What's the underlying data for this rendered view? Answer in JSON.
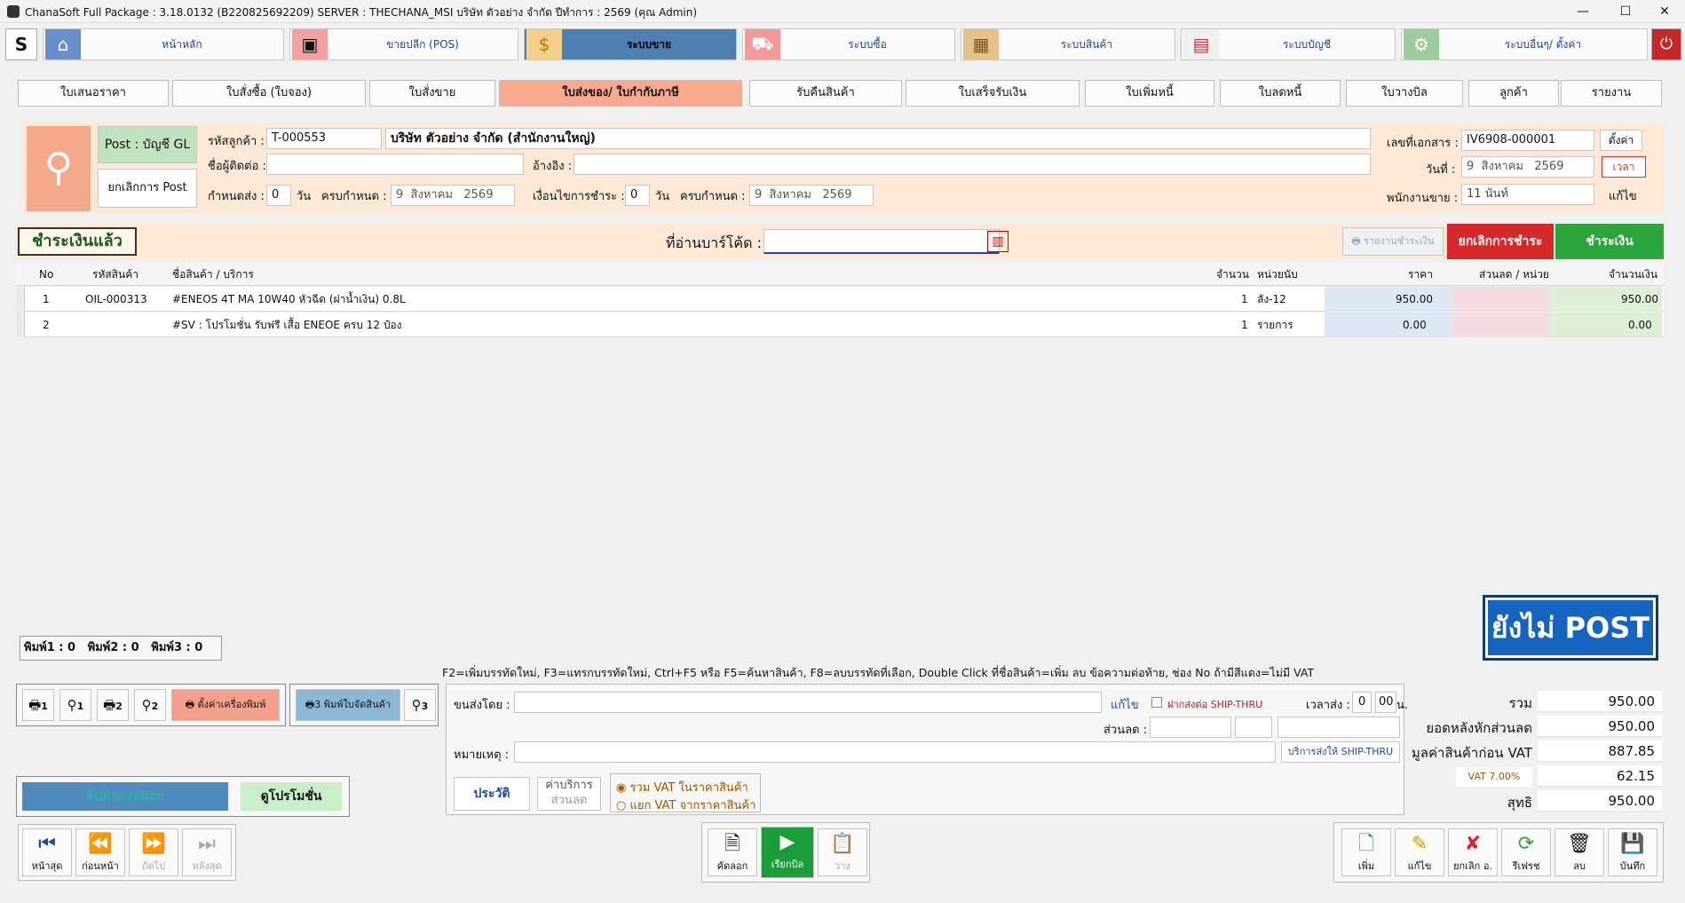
{
  "window": {
    "title": "ChanaSoft Full Package : 3.18.0132 (B220825692209) SERVER : THECHANA_MSI บริษัท ตัวอย่าง จำกัด ปีทำการ : 2569 (คุณ Admin)",
    "min": "—",
    "max": "☐",
    "close": "✕"
  },
  "menu": [
    {
      "label": "หน้าหลัก",
      "icon": "home-icon",
      "glyph": "⌂"
    },
    {
      "label": "ขายปลีก (POS)",
      "icon": "pos-terminal-icon",
      "glyph": "▣"
    },
    {
      "label": "ระบบขาย",
      "icon": "coin-icon",
      "glyph": "$"
    },
    {
      "label": "ระบบซื้อ",
      "icon": "cart-icon",
      "glyph": "🛒"
    },
    {
      "label": "ระบบสินค้า",
      "icon": "box-icon",
      "glyph": "▦"
    },
    {
      "label": "ระบบบัญชี",
      "icon": "report-icon",
      "glyph": "▤"
    },
    {
      "label": "ระบบอื่นๆ/ ตั้งค่า",
      "icon": "gear-icon",
      "glyph": "⚙"
    }
  ],
  "doc_tabs": [
    "ใบเสนอราคา",
    "ใบสั่งซื้อ (ใบจอง)",
    "ใบสั่งขาย",
    "ใบส่งของ/ ใบกำกับภาษี",
    "รับคืนสินค้า",
    "ใบเสร็จรับเงิน",
    "ใบเพิ่มหนี้",
    "ใบลดหนี้",
    "ใบวางบิล",
    "ลูกค้า",
    "รายงาน"
  ],
  "header": {
    "post_gl": "Post : บัญชี GL",
    "cancel_post": "ยกเลิกการ Post",
    "customer_code_label": "รหัสลูกค้า :",
    "customer_code": "T-000553",
    "customer_name": "บริษัท ตัวอย่าง จำกัด (สำนักงานใหญ่)",
    "contact_label": "ชื่อผู้ติดต่อ :",
    "contact": "",
    "ref_label": "อ้างอิง :",
    "ref": "",
    "due_label": "กำหนดส่ง :",
    "due_days": "0",
    "days_unit": "วัน",
    "due_date_label": "ครบกำหนด :",
    "due_date": {
      "d": "9",
      "m": "สิงหาคม",
      "y": "2569"
    },
    "credit_label": "เงื่อนไขการชำระ :",
    "credit_days": "0",
    "credit_unit": "วัน",
    "credit_date_label": "ครบกำหนด :",
    "credit_date": {
      "d": "9",
      "m": "สิงหาคม",
      "y": "2569"
    },
    "doc_no_label": "เลขที่เอกสาร :",
    "doc_no": "IV6908-000001",
    "setup": "ตั้งค่า",
    "date_label": "วันที่ :",
    "date": {
      "d": "9",
      "m": "สิงหาคม",
      "y": "2569"
    },
    "time_btn": "เวลา",
    "salesman_label": "พนักงานขาย :",
    "salesman": "11 นันท์",
    "edit": "แก้ไข"
  },
  "paybar": {
    "status": "ชำระเงินแล้ว",
    "barcode_label": "ที่อ่านบาร์โค้ด :",
    "barcode": "",
    "print_report": "รายงานชำระเงิน",
    "cancel_pay": "ยกเลิกการชำระ",
    "pay": "ชำระเงิน"
  },
  "grid": {
    "headers": {
      "no": "No",
      "code": "รหัสสินค้า",
      "name": "ชื่อสินค้า / บริการ",
      "qty": "จำนวน",
      "unit": "หน่วยนับ",
      "price": "ราคา",
      "disc": "ส่วนลด / หน่วย",
      "amount": "จำนวนเงิน"
    },
    "rows": [
      {
        "no": "1",
        "code": "OIL-000313",
        "name": "#ENEOS 4T MA 10W40 หัวฉีด (ฝาน้ำเงิน) 0.8L",
        "qty": "1",
        "unit": "ลัง-12",
        "price": "950.00",
        "disc": "",
        "amount": "950.00"
      },
      {
        "no": "2",
        "code": "",
        "name": "#SV : โปรโมชั่น รับฟรี เสื้อ  ENEOE  ครบ 12 ป๋อง",
        "qty": "1",
        "unit": "รายการ",
        "price": "0.00",
        "disc": "",
        "amount": "0.00"
      }
    ]
  },
  "not_post": "ยังไม่ POST",
  "print_counts": {
    "p1": "พิมพ์1 : 0",
    "p2": "พิมพ์2 : 0",
    "p3": "พิมพ์3 : 0"
  },
  "hint": "F2=เพิ่มบรรทัดใหม่,  F3=แทรกบรรทัดใหม่,  Ctrl+F5 หรือ F5=ค้นหาสินค้า,  F8=ลบบรรทัดที่เลือก,  Double Click ที่ชื่อสินค้า=เพิ่ม ลบ ข้อความต่อท้าย,  ช่อง No ถ้ามีสีแดง=ไม่มี VAT",
  "printers": {
    "b1": "1",
    "b1r": "1",
    "b2": "2",
    "b2r": "2",
    "setup": "ตั้งค่าเครื่องพิมพ์",
    "b3": "3",
    "pick": "พิมพ์ใบจัดสินค้า",
    "b3r": "3"
  },
  "ship": {
    "by_label": "ขนส่งโดย :",
    "by": "",
    "edit": "แก้ไข",
    "ship_thru": "ฝากส่งต่อ SHIP-THRU",
    "time_label": "เวลาส่ง :",
    "hh": "0",
    "mm": "00",
    "unit": "น.",
    "disc_label": "ส่วนลด :",
    "remark_label": "หมายเหตุ :",
    "ship_service": "บริการส่งให้ SHIP-THRU"
  },
  "history": "ประวัติ",
  "service": "ค่าบริการ",
  "discount": "ส่วนลด",
  "vat": {
    "include": "รวม VAT ในราคาสินค้า",
    "exclude": "แยก VAT จากราคาสินค้า"
  },
  "popular": "สินค้ายอดนิยม",
  "promo": "ดูโปรโมชั่น",
  "nav": {
    "first": "หน้าสุด",
    "prev": "ก่อนหน้า",
    "next": "ถัดไป",
    "last": "หลังสุด"
  },
  "mid": {
    "copy": "คัดลอก",
    "bill": "เรียกบิล",
    "paste": "วาง"
  },
  "actions": {
    "add": "เพิ่ม",
    "edit": "แก้ไข",
    "cancel": "ยกเลิก อ.",
    "refresh": "รีเฟรช",
    "delete": "ลบ",
    "save": "บันทึก"
  },
  "totals": {
    "sum_label": "รวม",
    "sum": "950.00",
    "after_disc_label": "ยอดหลังหักส่วนลด",
    "after_disc": "950.00",
    "before_vat_label": "มูลค่าสินค้าก่อน VAT",
    "before_vat": "887.85",
    "vat_label": "VAT 7.00%",
    "vat": "62.15",
    "net_label": "สุทธิ",
    "net": "950.00"
  }
}
